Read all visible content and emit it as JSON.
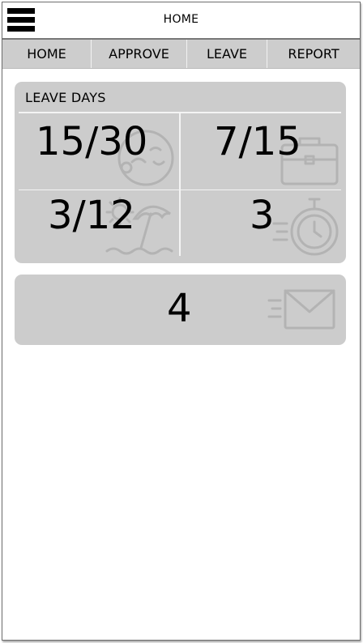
{
  "header": {
    "title": "HOME"
  },
  "tabs": [
    {
      "label": "HOME"
    },
    {
      "label": "APPROVE"
    },
    {
      "label": "LEAVE"
    },
    {
      "label": "REPORT"
    }
  ],
  "leave_days": {
    "title": "LEAVE DAYS",
    "stats": [
      {
        "value": "15/30",
        "icon": "sick-face-icon"
      },
      {
        "value": "7/15",
        "icon": "briefcase-icon"
      },
      {
        "value": "3/12",
        "icon": "beach-umbrella-icon"
      },
      {
        "value": "3",
        "icon": "stopwatch-icon"
      }
    ]
  },
  "messages": {
    "value": "4",
    "icon": "envelope-icon"
  },
  "colors": {
    "card": "#cccccc",
    "tabs": "#cdcdcd",
    "icon": "#b3b3b3"
  }
}
